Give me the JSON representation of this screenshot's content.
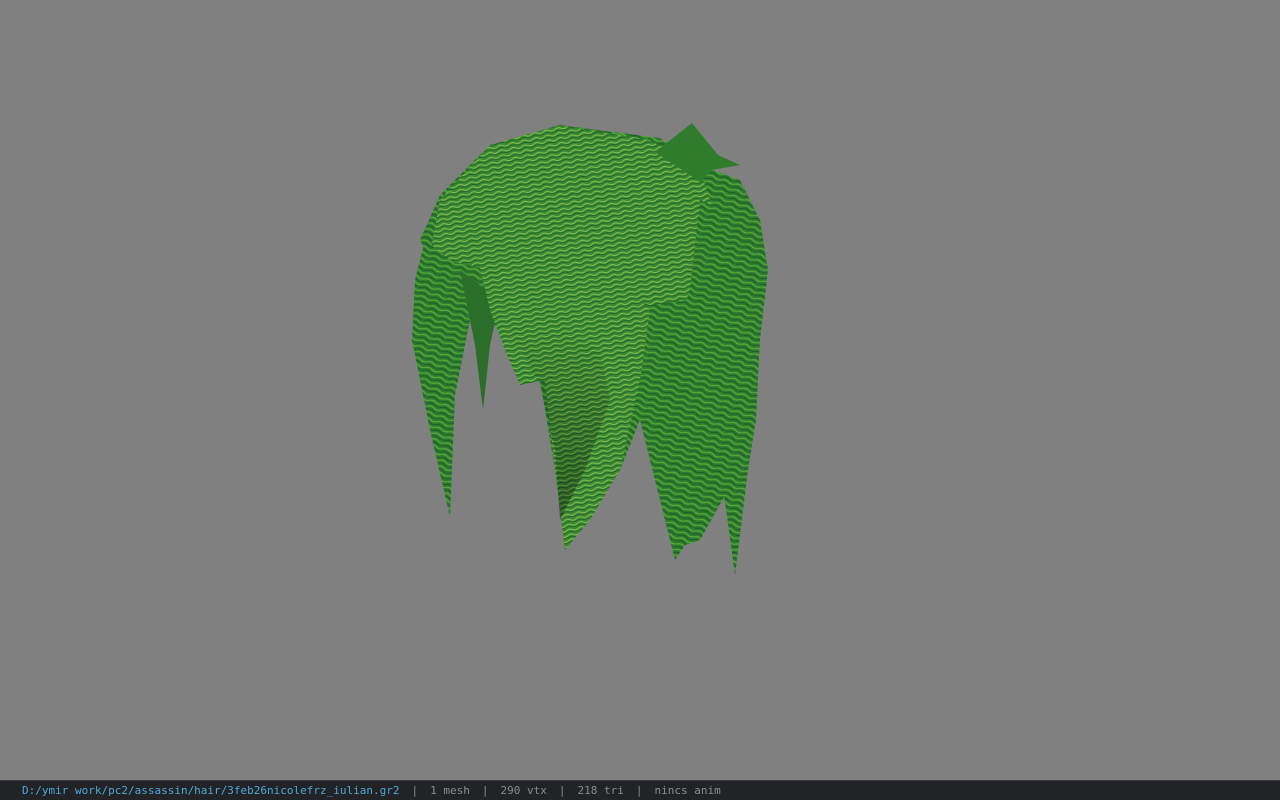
{
  "viewer": {
    "background_color": "#808080",
    "model_name": "hair-mesh",
    "model_color": "#2f7a2f"
  },
  "status_bar": {
    "file_path": "D:/ymir work/pc2/assassin/hair/3feb26nicolefrz_iulian.gr2",
    "separator": "|",
    "mesh_count": "1 mesh",
    "vertex_count": "290 vtx",
    "triangle_count": "218 tri",
    "anim_status": "nincs anim"
  }
}
